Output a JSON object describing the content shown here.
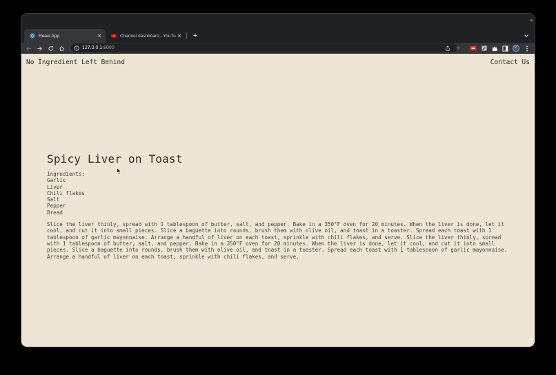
{
  "browser": {
    "tabs": [
      {
        "title": "React App",
        "icon": "react-icon",
        "active": true
      },
      {
        "title": "Channel dashboard - YouTube",
        "icon": "youtube-icon",
        "active": false
      }
    ],
    "url_host": "127.0.0.1",
    "url_port": ":8000",
    "profile_initial": "K"
  },
  "site": {
    "brand": "No Ingredient Left Behind",
    "contact_link": "Contact Us"
  },
  "recipe": {
    "title": "Spicy Liver on Toast",
    "ingredients_label": "Ingredients:",
    "ingredients": [
      "Garlic",
      "Liver",
      "Chili flakes",
      "Salt",
      "Pepper",
      "Bread"
    ],
    "instructions": "Slice the liver thinly, spread with 1 tablespoon of butter, salt, and pepper. Bake in a 350°F oven for 20 minutes. When the liver is done, let it cool, and cut it into small pieces. Slice a baguette into rounds, brush them with olive oil, and toast in a toaster. Spread each toast with 1 tablespoon of garlic mayonnaise. Arrange a handful of liver on each toast, sprinkle with chili flakes, and serve. Slice the liver thinly, spread with 1 tablespoon of butter, salt, and pepper. Bake in a 350°F oven for 20 minutes. When the liver is done, let it cool, and cut it into small pieces. Slice a baguette into rounds, brush them with olive oil, and toast in a toaster. Spread each toast with 1 tablespoon of garlic mayonnaise. Arrange a handful of liver on each toast, sprinkle with chili flakes, and serve."
  },
  "colors": {
    "page_background": "#efe5d5",
    "browser_chrome": "#35363a",
    "text": "#333333"
  }
}
